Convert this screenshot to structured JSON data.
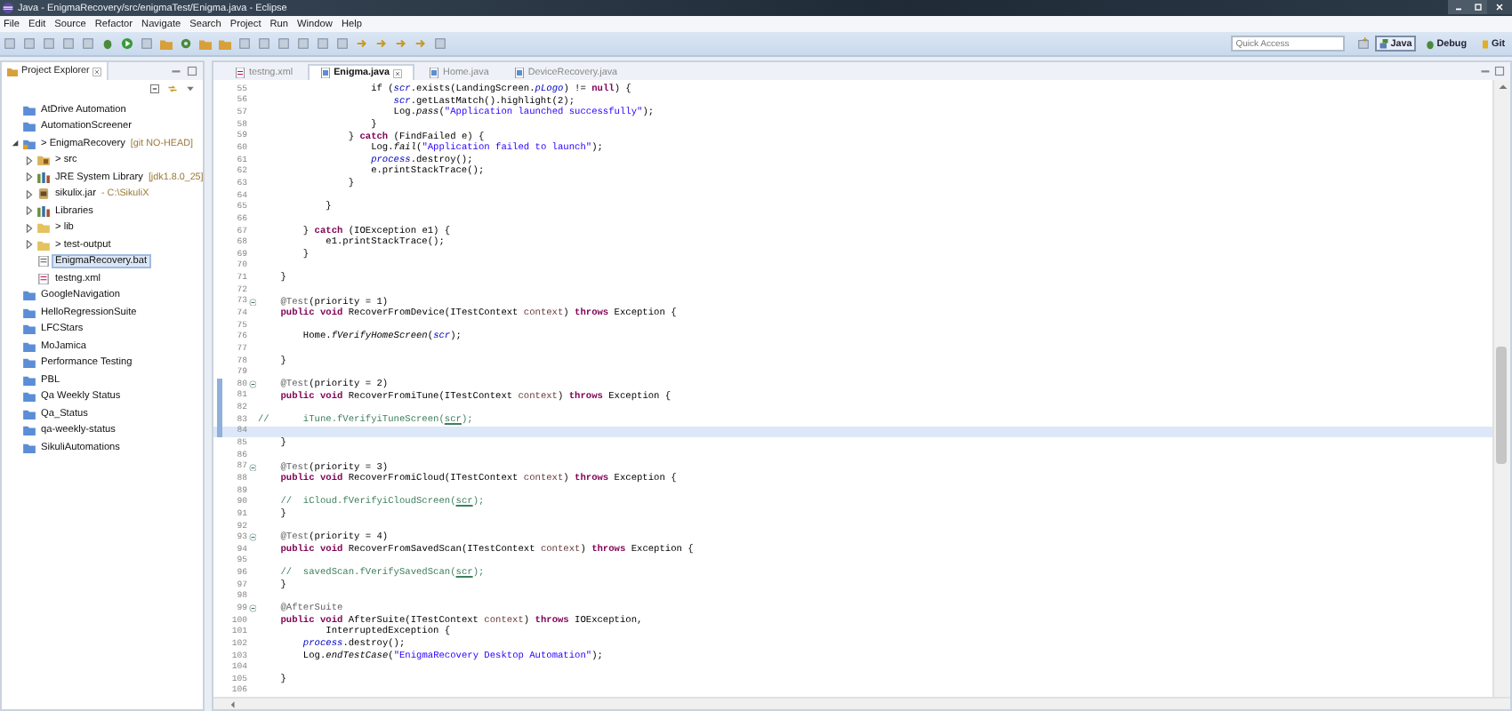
{
  "window": {
    "title": "Java - EnigmaRecovery/src/enigmaTest/Enigma.java - Eclipse"
  },
  "menu": [
    "File",
    "Edit",
    "Source",
    "Refactor",
    "Navigate",
    "Search",
    "Project",
    "Run",
    "Window",
    "Help"
  ],
  "toolbar": {
    "quick_access": {
      "placeholder": "Quick Access"
    },
    "perspectives": [
      {
        "label": "Java",
        "selected": true,
        "kind": "java"
      },
      {
        "label": "Debug",
        "selected": false,
        "kind": "debug"
      },
      {
        "label": "Git",
        "selected": false,
        "kind": "git"
      }
    ]
  },
  "project_explorer": {
    "title": "Project Explorer",
    "items": [
      {
        "label": "AtDrive Automation",
        "kind": "project",
        "selected": false
      },
      {
        "label": "AutomationScreener",
        "kind": "project",
        "selected": false
      },
      {
        "label": "> EnigmaRecovery",
        "decoration": "[git NO-HEAD]",
        "kind": "git-project",
        "selected": false,
        "expanded": true,
        "children": [
          {
            "label": "> src",
            "kind": "source",
            "selected": false,
            "expanded": false
          },
          {
            "label": "JRE System Library",
            "decoration": "[jdk1.8.0_25]",
            "kind": "library",
            "selected": false,
            "expanded": false
          },
          {
            "label": "sikulix.jar",
            "decoration": "- C:\\SikuliX",
            "kind": "jar",
            "selected": false,
            "expanded": false
          },
          {
            "label": "Libraries",
            "kind": "library",
            "selected": false,
            "expanded": false
          },
          {
            "label": "> lib",
            "kind": "folder",
            "selected": false,
            "expanded": false
          },
          {
            "label": "> test-output",
            "kind": "folder",
            "selected": false,
            "expanded": false
          },
          {
            "label": "EnigmaRecovery.bat",
            "kind": "file",
            "selected": true
          },
          {
            "label": "testng.xml",
            "kind": "xml",
            "selected": false
          }
        ]
      },
      {
        "label": "GoogleNavigation",
        "kind": "project",
        "selected": false
      },
      {
        "label": "HelloRegressionSuite",
        "kind": "project",
        "selected": false
      },
      {
        "label": "LFCStars",
        "kind": "project",
        "selected": false
      },
      {
        "label": "MoJamica",
        "kind": "project",
        "selected": false
      },
      {
        "label": "Performance Testing",
        "kind": "project",
        "selected": false
      },
      {
        "label": "PBL",
        "kind": "project",
        "selected": false
      },
      {
        "label": "Qa Weekly Status",
        "kind": "project",
        "selected": false
      },
      {
        "label": "Qa_Status",
        "kind": "project",
        "selected": false
      },
      {
        "label": "qa-weekly-status",
        "kind": "project",
        "selected": false
      },
      {
        "label": "SikuliAutomations",
        "kind": "project",
        "selected": false
      }
    ]
  },
  "editor": {
    "tabs": [
      {
        "label": "testng.xml",
        "kind": "xml",
        "selected": false
      },
      {
        "label": "Enigma.java",
        "kind": "java",
        "selected": true
      },
      {
        "label": "Home.java",
        "kind": "java",
        "selected": false
      },
      {
        "label": "DeviceRecovery.java",
        "kind": "java",
        "selected": false
      }
    ],
    "lines": [
      {
        "number": "55",
        "folding": false,
        "changed": false,
        "current": false,
        "tokens": [
          {
            "kind": "plain",
            "text": "                    if ("
          },
          {
            "kind": "field",
            "text": "scr"
          },
          {
            "kind": "plain",
            "text": ".exists(LandingScreen."
          },
          {
            "kind": "field",
            "text": "pLogo"
          },
          {
            "kind": "plain",
            "text": ") != "
          },
          {
            "kind": "keyword",
            "text": "null"
          },
          {
            "kind": "plain",
            "text": ") {"
          }
        ]
      },
      {
        "number": "56",
        "folding": false,
        "changed": false,
        "current": false,
        "tokens": [
          {
            "kind": "field",
            "text": "                        scr"
          },
          {
            "kind": "plain",
            "text": ".getLastMatch().highlight(2);"
          }
        ]
      },
      {
        "number": "57",
        "folding": false,
        "changed": false,
        "current": false,
        "tokens": [
          {
            "kind": "plain",
            "text": "                        Log."
          },
          {
            "kind": "static",
            "text": "pass"
          },
          {
            "kind": "plain",
            "text": "("
          },
          {
            "kind": "string",
            "text": "\"Application launched successfully\""
          },
          {
            "kind": "plain",
            "text": ");"
          }
        ]
      },
      {
        "number": "58",
        "folding": false,
        "changed": false,
        "current": false,
        "tokens": [
          {
            "kind": "plain",
            "text": "                    }"
          }
        ]
      },
      {
        "number": "59",
        "folding": false,
        "changed": false,
        "current": false,
        "tokens": [
          {
            "kind": "plain",
            "text": "                } "
          },
          {
            "kind": "keyword",
            "text": "catch"
          },
          {
            "kind": "plain",
            "text": " (FindFailed e) {"
          }
        ]
      },
      {
        "number": "60",
        "folding": false,
        "changed": false,
        "current": false,
        "tokens": [
          {
            "kind": "plain",
            "text": "                    Log."
          },
          {
            "kind": "static",
            "text": "fail"
          },
          {
            "kind": "plain",
            "text": "("
          },
          {
            "kind": "string",
            "text": "\"Application failed to launch\""
          },
          {
            "kind": "plain",
            "text": ");"
          }
        ]
      },
      {
        "number": "61",
        "folding": false,
        "changed": false,
        "current": false,
        "tokens": [
          {
            "kind": "field",
            "text": "                    process"
          },
          {
            "kind": "plain",
            "text": ".destroy();"
          }
        ]
      },
      {
        "number": "62",
        "folding": false,
        "changed": false,
        "current": false,
        "tokens": [
          {
            "kind": "plain",
            "text": "                    e.printStackTrace();"
          }
        ]
      },
      {
        "number": "63",
        "folding": false,
        "changed": false,
        "current": false,
        "tokens": [
          {
            "kind": "plain",
            "text": "                }"
          }
        ]
      },
      {
        "number": "64",
        "folding": false,
        "changed": false,
        "current": false
      },
      {
        "number": "65",
        "folding": false,
        "changed": false,
        "current": false,
        "tokens": [
          {
            "kind": "plain",
            "text": "            }"
          }
        ]
      },
      {
        "number": "66",
        "folding": false,
        "changed": false,
        "current": false
      },
      {
        "number": "67",
        "folding": false,
        "changed": false,
        "current": false,
        "tokens": [
          {
            "kind": "plain",
            "text": "        } "
          },
          {
            "kind": "keyword",
            "text": "catch"
          },
          {
            "kind": "plain",
            "text": " (IOException e1) {"
          }
        ]
      },
      {
        "number": "68",
        "folding": false,
        "changed": false,
        "current": false,
        "tokens": [
          {
            "kind": "plain",
            "text": "            e1.printStackTrace();"
          }
        ]
      },
      {
        "number": "69",
        "folding": false,
        "changed": false,
        "current": false,
        "tokens": [
          {
            "kind": "plain",
            "text": "        }"
          }
        ]
      },
      {
        "number": "70",
        "folding": false,
        "changed": false,
        "current": false
      },
      {
        "number": "71",
        "folding": false,
        "changed": false,
        "current": false,
        "tokens": [
          {
            "kind": "plain",
            "text": "    }"
          }
        ]
      },
      {
        "number": "72",
        "folding": false,
        "changed": false,
        "current": false
      },
      {
        "number": "73",
        "folding": true,
        "changed": false,
        "current": false,
        "tokens": [
          {
            "kind": "annotation",
            "text": "    @Test"
          },
          {
            "kind": "plain",
            "text": "(priority = 1)"
          }
        ]
      },
      {
        "number": "74",
        "folding": false,
        "changed": false,
        "current": false,
        "tokens": [
          {
            "kind": "keyword",
            "text": "    public void"
          },
          {
            "kind": "plain",
            "text": " RecoverFromDevice(ITestContext "
          },
          {
            "kind": "param",
            "text": "context"
          },
          {
            "kind": "plain",
            "text": ") "
          },
          {
            "kind": "keyword",
            "text": "throws"
          },
          {
            "kind": "plain",
            "text": " Exception {"
          }
        ]
      },
      {
        "number": "75",
        "folding": false,
        "changed": false,
        "current": false
      },
      {
        "number": "76",
        "folding": false,
        "changed": false,
        "current": false,
        "tokens": [
          {
            "kind": "plain",
            "text": "        Home."
          },
          {
            "kind": "static",
            "text": "fVerifyHomeScreen"
          },
          {
            "kind": "plain",
            "text": "("
          },
          {
            "kind": "field",
            "text": "scr"
          },
          {
            "kind": "plain",
            "text": ");"
          }
        ]
      },
      {
        "number": "77",
        "folding": false,
        "changed": false,
        "current": false
      },
      {
        "number": "78",
        "folding": false,
        "changed": false,
        "current": false,
        "tokens": [
          {
            "kind": "plain",
            "text": "    }"
          }
        ]
      },
      {
        "number": "79",
        "folding": false,
        "changed": false,
        "current": false
      },
      {
        "number": "80",
        "folding": true,
        "changed": true,
        "current": false,
        "tokens": [
          {
            "kind": "annotation",
            "text": "    @Test"
          },
          {
            "kind": "plain",
            "text": "(priority = 2)"
          }
        ]
      },
      {
        "number": "81",
        "folding": false,
        "changed": true,
        "current": false,
        "tokens": [
          {
            "kind": "keyword",
            "text": "    public void"
          },
          {
            "kind": "plain",
            "text": " RecoverFromiTune(ITestContext "
          },
          {
            "kind": "param",
            "text": "context"
          },
          {
            "kind": "plain",
            "text": ") "
          },
          {
            "kind": "keyword",
            "text": "throws"
          },
          {
            "kind": "plain",
            "text": " Exception {"
          }
        ]
      },
      {
        "number": "82",
        "folding": false,
        "changed": true,
        "current": false
      },
      {
        "number": "83",
        "folding": false,
        "changed": true,
        "current": false,
        "tokens": [
          {
            "kind": "comment",
            "text": "//      iTune.fVerifyiTuneScreen("
          },
          {
            "kind": "comment-underlined",
            "text": "scr"
          },
          {
            "kind": "comment",
            "text": ");"
          }
        ]
      },
      {
        "number": "84",
        "folding": false,
        "changed": true,
        "current": true
      },
      {
        "number": "85",
        "folding": false,
        "changed": false,
        "current": false,
        "tokens": [
          {
            "kind": "plain",
            "text": "    }"
          }
        ]
      },
      {
        "number": "86",
        "folding": false,
        "changed": false,
        "current": false
      },
      {
        "number": "87",
        "folding": true,
        "changed": false,
        "current": false,
        "tokens": [
          {
            "kind": "annotation",
            "text": "    @Test"
          },
          {
            "kind": "plain",
            "text": "(priority = 3)"
          }
        ]
      },
      {
        "number": "88",
        "folding": false,
        "changed": false,
        "current": false,
        "tokens": [
          {
            "kind": "keyword",
            "text": "    public void"
          },
          {
            "kind": "plain",
            "text": " RecoverFromiCloud(ITestContext "
          },
          {
            "kind": "param",
            "text": "context"
          },
          {
            "kind": "plain",
            "text": ") "
          },
          {
            "kind": "keyword",
            "text": "throws"
          },
          {
            "kind": "plain",
            "text": " Exception {"
          }
        ]
      },
      {
        "number": "89",
        "folding": false,
        "changed": false,
        "current": false
      },
      {
        "number": "90",
        "folding": false,
        "changed": false,
        "current": false,
        "tokens": [
          {
            "kind": "comment",
            "text": "    //  iCloud.fVerifyiCloudScreen("
          },
          {
            "kind": "comment-underlined",
            "text": "scr"
          },
          {
            "kind": "comment",
            "text": ");"
          }
        ]
      },
      {
        "number": "91",
        "folding": false,
        "changed": false,
        "current": false,
        "tokens": [
          {
            "kind": "plain",
            "text": "    }"
          }
        ]
      },
      {
        "number": "92",
        "folding": false,
        "changed": false,
        "current": false
      },
      {
        "number": "93",
        "folding": true,
        "changed": false,
        "current": false,
        "tokens": [
          {
            "kind": "annotation",
            "text": "    @Test"
          },
          {
            "kind": "plain",
            "text": "(priority = 4)"
          }
        ]
      },
      {
        "number": "94",
        "folding": false,
        "changed": false,
        "current": false,
        "tokens": [
          {
            "kind": "keyword",
            "text": "    public void"
          },
          {
            "kind": "plain",
            "text": " RecoverFromSavedScan(ITestContext "
          },
          {
            "kind": "param",
            "text": "context"
          },
          {
            "kind": "plain",
            "text": ") "
          },
          {
            "kind": "keyword",
            "text": "throws"
          },
          {
            "kind": "plain",
            "text": " Exception {"
          }
        ]
      },
      {
        "number": "95",
        "folding": false,
        "changed": false,
        "current": false
      },
      {
        "number": "96",
        "folding": false,
        "changed": false,
        "current": false,
        "tokens": [
          {
            "kind": "comment",
            "text": "    //  savedScan.fVerifySavedScan("
          },
          {
            "kind": "comment-underlined",
            "text": "scr"
          },
          {
            "kind": "comment",
            "text": ");"
          }
        ]
      },
      {
        "number": "97",
        "folding": false,
        "changed": false,
        "current": false,
        "tokens": [
          {
            "kind": "plain",
            "text": "    }"
          }
        ]
      },
      {
        "number": "98",
        "folding": false,
        "changed": false,
        "current": false
      },
      {
        "number": "99",
        "folding": true,
        "changed": false,
        "current": false,
        "tokens": [
          {
            "kind": "annotation",
            "text": "    @AfterSuite"
          }
        ]
      },
      {
        "number": "100",
        "folding": false,
        "changed": false,
        "current": false,
        "tokens": [
          {
            "kind": "keyword",
            "text": "    public void"
          },
          {
            "kind": "plain",
            "text": " AfterSuite(ITestContext "
          },
          {
            "kind": "param",
            "text": "context"
          },
          {
            "kind": "plain",
            "text": ") "
          },
          {
            "kind": "keyword",
            "text": "throws"
          },
          {
            "kind": "plain",
            "text": " IOException,"
          }
        ]
      },
      {
        "number": "101",
        "folding": false,
        "changed": false,
        "current": false,
        "tokens": [
          {
            "kind": "plain",
            "text": "            InterruptedException {"
          }
        ]
      },
      {
        "number": "102",
        "folding": false,
        "changed": false,
        "current": false,
        "tokens": [
          {
            "kind": "field",
            "text": "        process"
          },
          {
            "kind": "plain",
            "text": ".destroy();"
          }
        ]
      },
      {
        "number": "103",
        "folding": false,
        "changed": false,
        "current": false,
        "tokens": [
          {
            "kind": "plain",
            "text": "        Log."
          },
          {
            "kind": "static",
            "text": "endTestCase"
          },
          {
            "kind": "plain",
            "text": "("
          },
          {
            "kind": "string",
            "text": "\"EnigmaRecovery Desktop Automation\""
          },
          {
            "kind": "plain",
            "text": ");"
          }
        ]
      },
      {
        "number": "104",
        "folding": false,
        "changed": false,
        "current": false
      },
      {
        "number": "105",
        "folding": false,
        "changed": false,
        "current": false,
        "tokens": [
          {
            "kind": "plain",
            "text": "    }"
          }
        ]
      },
      {
        "number": "106",
        "folding": false,
        "changed": false,
        "current": false
      }
    ]
  }
}
